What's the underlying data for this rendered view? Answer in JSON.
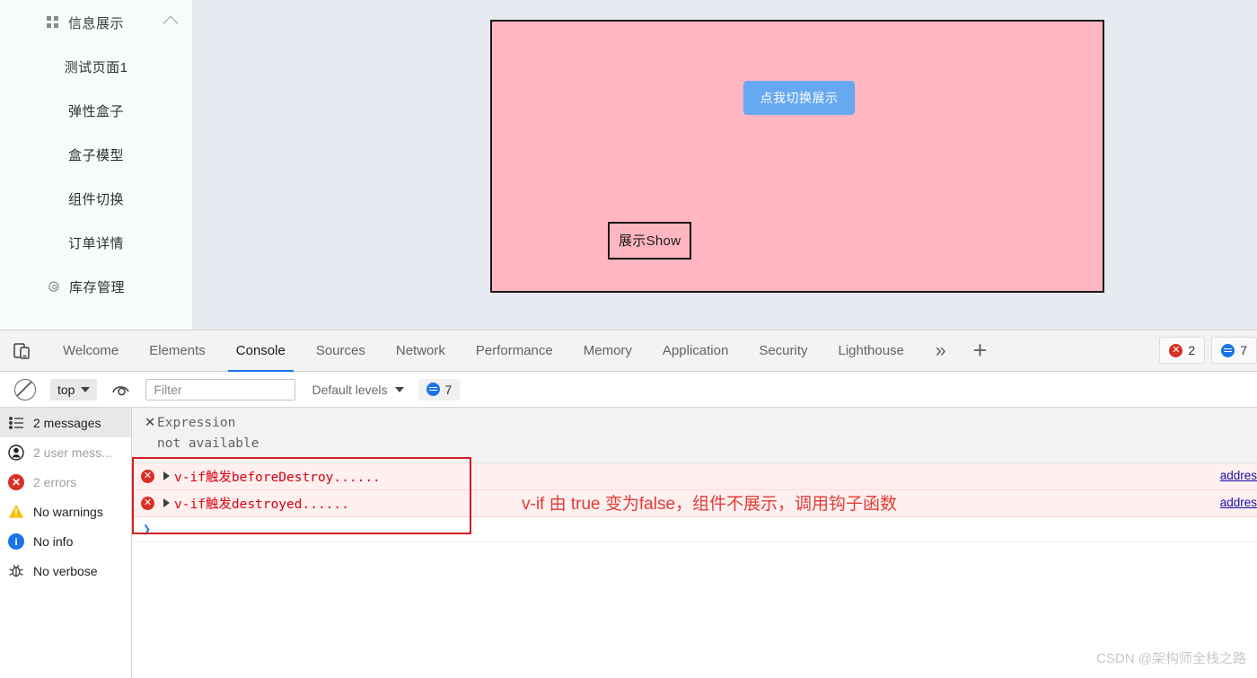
{
  "sidebar": {
    "title": "信息展示",
    "collapse_icon": "chevron-up-icon",
    "grid_icon": "grid-icon",
    "items": [
      {
        "label": "测试页面1",
        "icon": null
      },
      {
        "label": "弹性盒子",
        "icon": null
      },
      {
        "label": "盒子模型",
        "icon": null
      },
      {
        "label": "组件切换",
        "icon": null
      },
      {
        "label": "订单详情",
        "icon": null
      },
      {
        "label": "库存管理",
        "icon": "gear-icon"
      }
    ]
  },
  "page": {
    "box_background": "#ffb6c1",
    "toggle_button_label": "点我切换展示",
    "toggle_button_color": "#66a8f2",
    "show_box_label": "展示Show",
    "canvas_background": "#e8eaf1"
  },
  "devtools": {
    "inspect_icon": "device-toolbar-icon",
    "tabs": [
      {
        "label": "Welcome",
        "active": false
      },
      {
        "label": "Elements",
        "active": false
      },
      {
        "label": "Console",
        "active": true
      },
      {
        "label": "Sources",
        "active": false
      },
      {
        "label": "Network",
        "active": false
      },
      {
        "label": "Performance",
        "active": false
      },
      {
        "label": "Memory",
        "active": false
      },
      {
        "label": "Application",
        "active": false
      },
      {
        "label": "Security",
        "active": false
      },
      {
        "label": "Lighthouse",
        "active": false
      }
    ],
    "more_tabs_icon": "»",
    "add_tab_icon": "+",
    "badges": {
      "errors": "2",
      "messages": "7"
    },
    "toolbar": {
      "clear_icon": "clear-console-icon",
      "context": "top",
      "eye_icon": "live-expression-icon",
      "filter_placeholder": "Filter",
      "filter_value": "",
      "levels": "Default levels",
      "message_count": "7"
    },
    "console_sidebar": [
      {
        "label": "2 messages",
        "icon": "list-icon",
        "selected": true,
        "dim": false
      },
      {
        "label": "2 user mess...",
        "icon": "user-icon",
        "selected": false,
        "dim": true
      },
      {
        "label": "2 errors",
        "icon": "error-icon",
        "selected": false,
        "dim": true
      },
      {
        "label": "No warnings",
        "icon": "warning-icon",
        "selected": false,
        "dim": false
      },
      {
        "label": "No info",
        "icon": "info-icon",
        "selected": false,
        "dim": false
      },
      {
        "label": "No verbose",
        "icon": "bug-icon",
        "selected": false,
        "dim": false
      }
    ],
    "expression": {
      "close_icon": "✕",
      "line1": "Expression",
      "line2": "not available"
    },
    "messages": [
      {
        "text": "v-if触发beforeDestroy......",
        "source": "addres",
        "level": "error"
      },
      {
        "text": "v-if触发destroyed......",
        "source": "addres",
        "level": "error"
      }
    ],
    "prompt_symbol": "❯"
  },
  "annotation": {
    "text": "v-if 由 true 变为false，组件不展示，调用钩子函数",
    "color": "#e23b35"
  },
  "watermark": "CSDN @架构师全栈之路"
}
